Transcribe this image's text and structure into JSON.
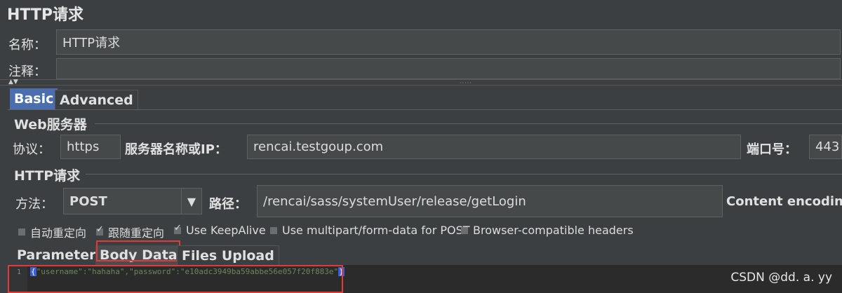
{
  "window": {
    "title": "HTTP请求"
  },
  "name_row": {
    "label": "名称：",
    "value": "HTTP请求"
  },
  "comment_row": {
    "label": "注释：",
    "value": ""
  },
  "main_tabs": [
    {
      "label": "Basic",
      "active": true
    },
    {
      "label": "Advanced",
      "active": false
    }
  ],
  "web_server": {
    "title": "Web服务器",
    "protocol_label": "协议：",
    "protocol_value": "https",
    "server_label": "服务器名称或IP：",
    "server_value": "rencai.testgoup.com",
    "port_label": "端口号：",
    "port_value": "443"
  },
  "http_request": {
    "title": "HTTP请求",
    "method_label": "方法：",
    "method_value": "POST",
    "path_label": "路径：",
    "path_value": "/rencai/sass/systemUser/release/getLogin",
    "content_encoding_label": "Content encodin"
  },
  "options": [
    {
      "label": "自动重定向",
      "checked": false
    },
    {
      "label": "跟随重定向",
      "checked": true
    },
    {
      "label": "Use KeepAlive",
      "checked": true
    },
    {
      "label": "Use multipart/form-data for POST",
      "checked": false
    },
    {
      "label": "Browser-compatible headers",
      "checked": false
    }
  ],
  "sub_tabs": [
    {
      "label": "Parameters",
      "active": false
    },
    {
      "label": "Body Data",
      "active": true
    },
    {
      "label": "Files Upload",
      "active": false
    }
  ],
  "editor": {
    "line_number": "1",
    "brace_open": "{",
    "body": "\"username\":\"hahaha\",\"password\":\"e10adc3949ba59abbe56e057f20f883e\"",
    "brace_close": "}"
  },
  "watermark": "CSDN @dd. a. yy",
  "colors": {
    "background": "#3c3f41",
    "accent_tab": "#4b6eaf",
    "highlight_border": "#e03a3a",
    "code_string": "#6a8759"
  }
}
